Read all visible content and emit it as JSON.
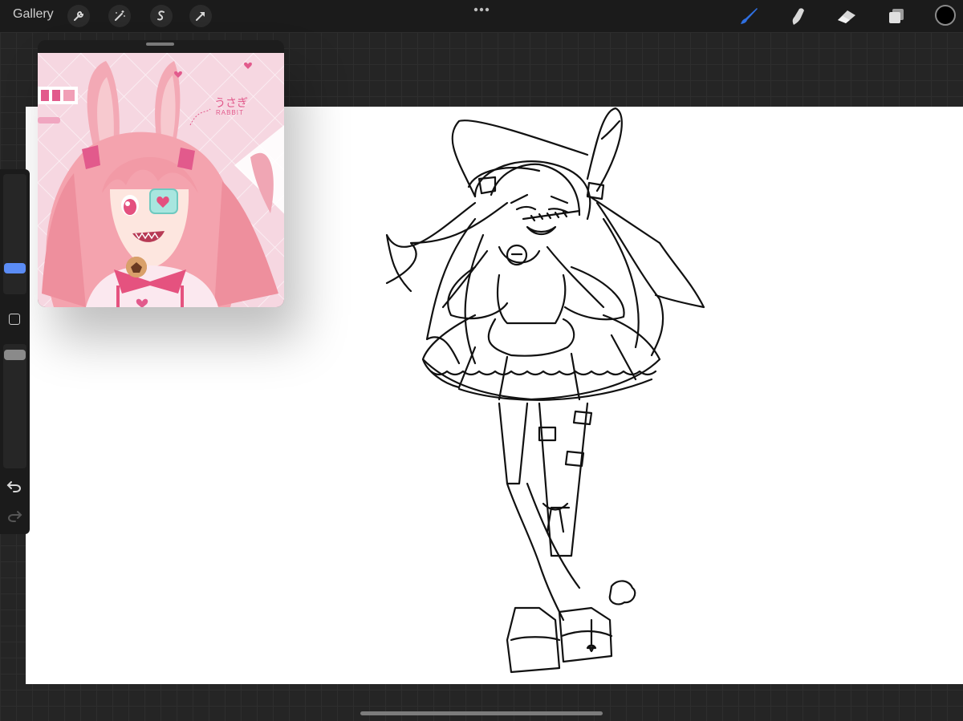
{
  "toolbar": {
    "gallery_label": "Gallery",
    "left_icons": [
      "wrench-icon",
      "magic-wand-icon",
      "selection-s-icon",
      "transform-arrow-icon"
    ],
    "right_icons": [
      "brush-icon",
      "smudge-icon",
      "eraser-icon",
      "layers-icon"
    ],
    "brush_color": "#2f6fe0",
    "current_color": "#000000"
  },
  "reference": {
    "kana_text": "うさぎ",
    "rabbit_text": "RABBIT",
    "background_color": "#f6d7e1",
    "accent_color": "#e25a8c"
  },
  "sidebar": {
    "brush_size_level": 0.27,
    "opacity_level": 0.0,
    "size_handle_color": "#5b8cf5",
    "opacity_handle_color": "#8a8a8a"
  },
  "canvas": {
    "background": "#ffffff"
  }
}
